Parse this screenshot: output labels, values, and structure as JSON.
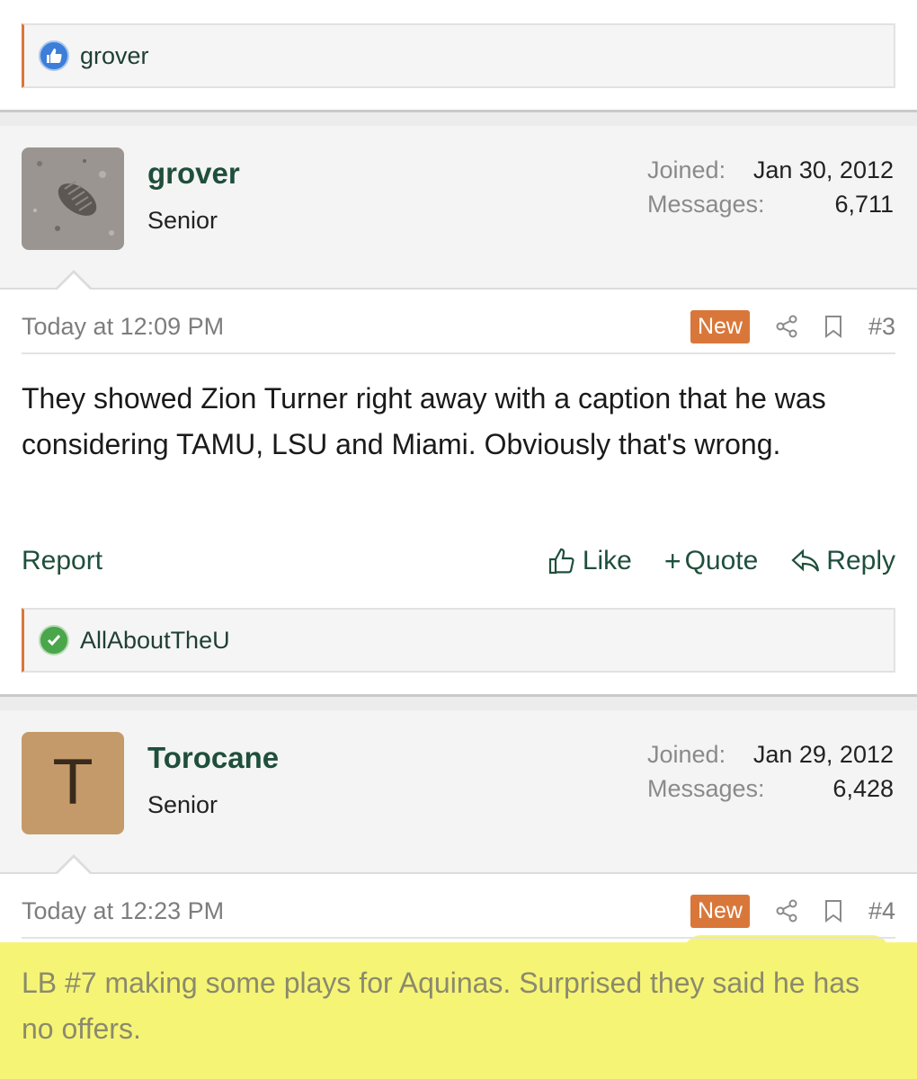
{
  "reaction_bar_1": {
    "name": "grover",
    "icon": "thumbs-up-icon"
  },
  "post_3": {
    "user": {
      "name": "grover",
      "title": "Senior",
      "joined_label": "Joined:",
      "joined": "Jan 30, 2012",
      "messages_label": "Messages:",
      "messages": "6,711"
    },
    "date": "Today at 12:09 PM",
    "new_label": "New",
    "number": "#3",
    "body": "They showed Zion Turner right away with a caption that he was considering TAMU, LSU and Miami. Obviously that's wrong.",
    "actions": {
      "report": "Report",
      "like": "Like",
      "quote": "Quote",
      "reply": "Reply"
    }
  },
  "reaction_bar_2": {
    "name": "AllAboutTheU",
    "icon": "check-circle-icon"
  },
  "post_4": {
    "user": {
      "name": "Torocane",
      "title": "Senior",
      "avatar_letter": "T",
      "joined_label": "Joined:",
      "joined": "Jan 29, 2012",
      "messages_label": "Messages:",
      "messages": "6,428"
    },
    "date": "Today at 12:23 PM",
    "new_label": "New",
    "number": "#4",
    "body": "LB #7 making some plays for Aquinas. Surprised they said he has no offers."
  },
  "colors": {
    "accent": "#d9773a",
    "link": "#1f4f3c",
    "highlight": "#f6f475"
  }
}
